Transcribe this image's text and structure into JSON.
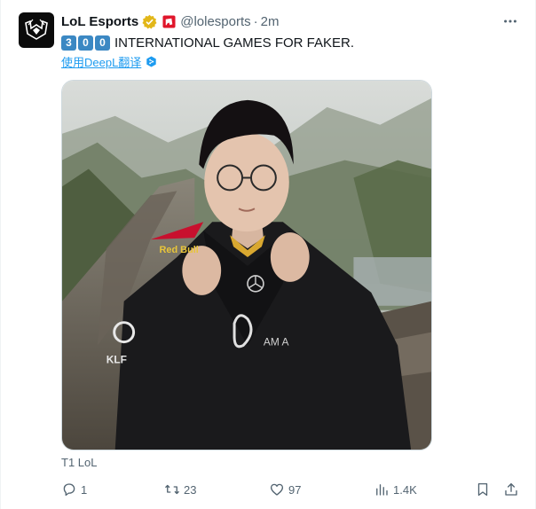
{
  "tweet": {
    "author_name": "LoL Esports",
    "handle": "@lolesports",
    "separator": "·",
    "time": "2m",
    "keycaps": [
      "3",
      "0",
      "0"
    ],
    "text": "INTERNATIONAL GAMES FOR FAKER.",
    "translate_label": "使用DeepL翻译",
    "media_caption": "T1 LoL",
    "icons": {
      "avatar": "lol-esports-logo",
      "verified": "gold-verified-badge-icon",
      "affiliate": "riot-affiliate-icon",
      "more": "more-dots-icon",
      "translate": "deepl-icon"
    }
  },
  "actions": {
    "reply": {
      "icon": "reply-icon",
      "count": "1"
    },
    "retweet": {
      "icon": "retweet-icon",
      "count": "23"
    },
    "like": {
      "icon": "heart-icon",
      "count": "97"
    },
    "views": {
      "icon": "analytics-icon",
      "count": "1.4K"
    },
    "bookmark": {
      "icon": "bookmark-icon"
    },
    "share": {
      "icon": "share-icon"
    }
  },
  "colors": {
    "text": "#0f1419",
    "secondary": "#536471",
    "link": "#1d9bf0",
    "keycap": "#3b88c3",
    "verified_gold": "#e2b719"
  }
}
